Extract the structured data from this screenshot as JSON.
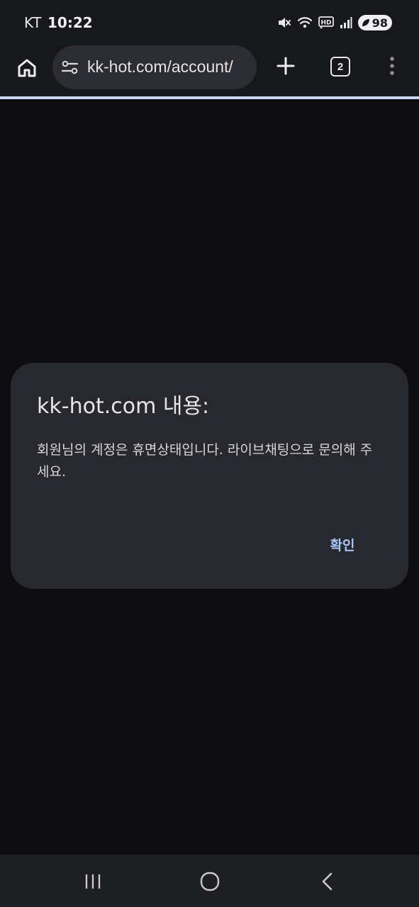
{
  "status_bar": {
    "carrier": "KT",
    "time": "10:22",
    "battery": "98",
    "icons": [
      "mute-icon",
      "wifi-icon",
      "hd-volte-icon",
      "signal-icon",
      "battery-saver-leaf-icon"
    ]
  },
  "browser": {
    "url": "kk-hot.com/account/",
    "tab_count": "2",
    "icons": [
      "home-icon",
      "site-settings-icon",
      "plus-icon",
      "tab-switcher-icon",
      "more-vert-icon"
    ],
    "accent_color": "#c9d4ee"
  },
  "dialog": {
    "title": "kk-hot.com 내용:",
    "message": "회원님의 계정은 휴면상태입니다. 라이브채팅으로 문의해 주세요.",
    "confirm_label": "확인",
    "button_color": "#a8c7fa"
  },
  "nav_bar": {
    "icons": [
      "recent-apps-icon",
      "home-circle-icon",
      "back-icon"
    ]
  }
}
